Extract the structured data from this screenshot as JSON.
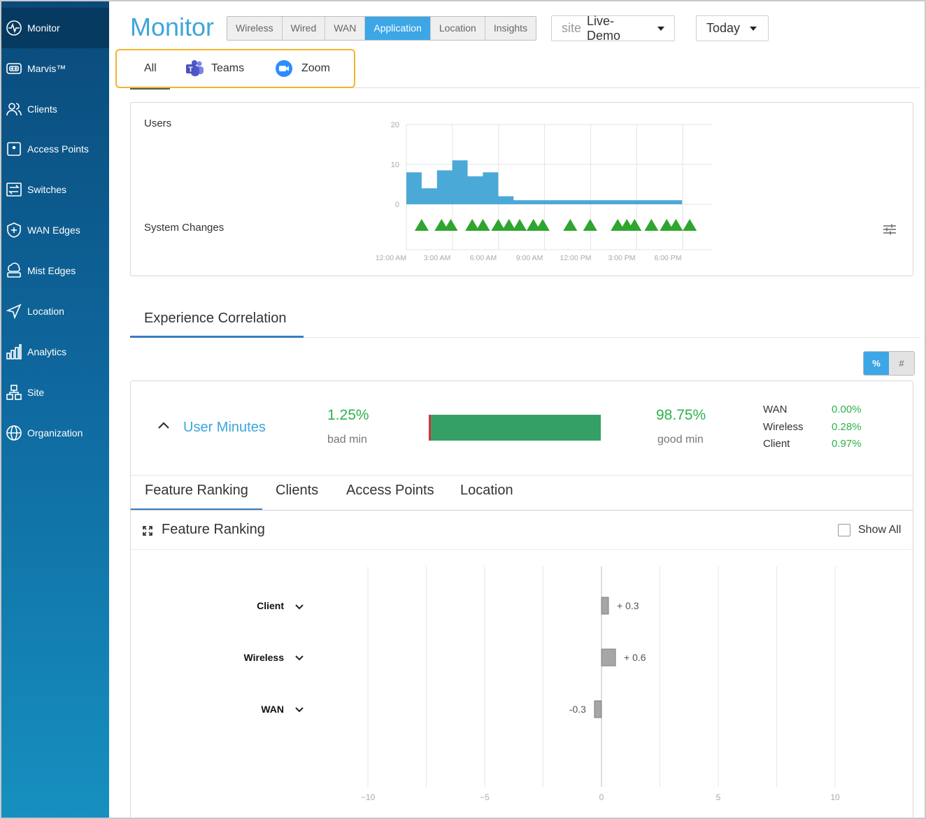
{
  "sidebar": {
    "items": [
      {
        "label": "Monitor",
        "icon": "monitor-icon"
      },
      {
        "label": "Marvis™",
        "icon": "marvis-icon"
      },
      {
        "label": "Clients",
        "icon": "clients-icon"
      },
      {
        "label": "Access Points",
        "icon": "access-point-icon"
      },
      {
        "label": "Switches",
        "icon": "switch-icon"
      },
      {
        "label": "WAN Edges",
        "icon": "wan-edge-icon"
      },
      {
        "label": "Mist Edges",
        "icon": "mist-edge-icon"
      },
      {
        "label": "Location",
        "icon": "location-icon"
      },
      {
        "label": "Analytics",
        "icon": "analytics-icon"
      },
      {
        "label": "Site",
        "icon": "site-icon"
      },
      {
        "label": "Organization",
        "icon": "organization-icon"
      }
    ],
    "active": "Monitor"
  },
  "header": {
    "title": "Monitor",
    "view_tabs": [
      "Wireless",
      "Wired",
      "WAN",
      "Application",
      "Location",
      "Insights"
    ],
    "active_tab": "Application",
    "site_prefix": "site",
    "site_value": "Live-Demo",
    "time_value": "Today"
  },
  "app_filter": {
    "items": [
      "All",
      "Teams",
      "Zoom"
    ],
    "active": "All"
  },
  "timeline": {
    "users_label": "Users",
    "changes_label": "System Changes",
    "colors": {
      "bars": "#4aa9d6",
      "changes": "#2ea52e"
    }
  },
  "chart_data": [
    {
      "type": "area",
      "title": "",
      "ylabel": "Users",
      "ylim": [
        0,
        20
      ],
      "yticks": [
        "20",
        "10",
        "0"
      ],
      "xticks": [
        "12:00 AM",
        "3:00 AM",
        "6:00 AM",
        "9:00 AM",
        "12:00 PM",
        "3:00 PM",
        "6:00 PM"
      ],
      "x_hours": [
        0,
        1,
        2,
        3,
        4,
        5,
        6,
        7,
        8,
        9,
        10,
        11,
        12,
        13,
        14,
        15,
        16,
        17,
        18
      ],
      "values": [
        8,
        4,
        8.5,
        11,
        7,
        8,
        2,
        1,
        1,
        1,
        1,
        1,
        1,
        1,
        1,
        1,
        1,
        1,
        0
      ],
      "system_changes_hours": [
        1,
        2.3,
        2.9,
        4.3,
        5.0,
        6.0,
        6.7,
        7.4,
        8.3,
        8.9,
        10.7,
        12.0,
        13.8,
        14.4,
        14.9,
        16.0,
        17.0,
        17.6,
        18.5
      ]
    },
    {
      "type": "bar",
      "title": "Feature Ranking",
      "categories": [
        "Client",
        "Wireless",
        "WAN"
      ],
      "values": [
        0.3,
        0.6,
        -0.3
      ],
      "value_labels": [
        "+ 0.3",
        "+ 0.6",
        "-0.3"
      ],
      "xlim": [
        -10,
        10
      ],
      "xticks": [
        "−10",
        "−5",
        "0",
        "5",
        "10"
      ],
      "grid": true
    }
  ],
  "experience": {
    "title": "Experience Correlation",
    "toggle": {
      "percent": "%",
      "count": "#",
      "active": "%"
    },
    "metric": "User Minutes",
    "bad_value": "1.25%",
    "bad_label": "bad min",
    "good_value": "98.75%",
    "good_label": "good min",
    "bad_fraction": 0.0125,
    "breakdown": [
      {
        "name": "WAN",
        "value": "0.00%"
      },
      {
        "name": "Wireless",
        "value": "0.28%"
      },
      {
        "name": "Client",
        "value": "0.97%"
      }
    ],
    "tabs": [
      "Feature Ranking",
      "Clients",
      "Access Points",
      "Location"
    ],
    "active_tab": "Feature Ranking",
    "ranking_title": "Feature Ranking",
    "show_all_label": "Show All"
  }
}
